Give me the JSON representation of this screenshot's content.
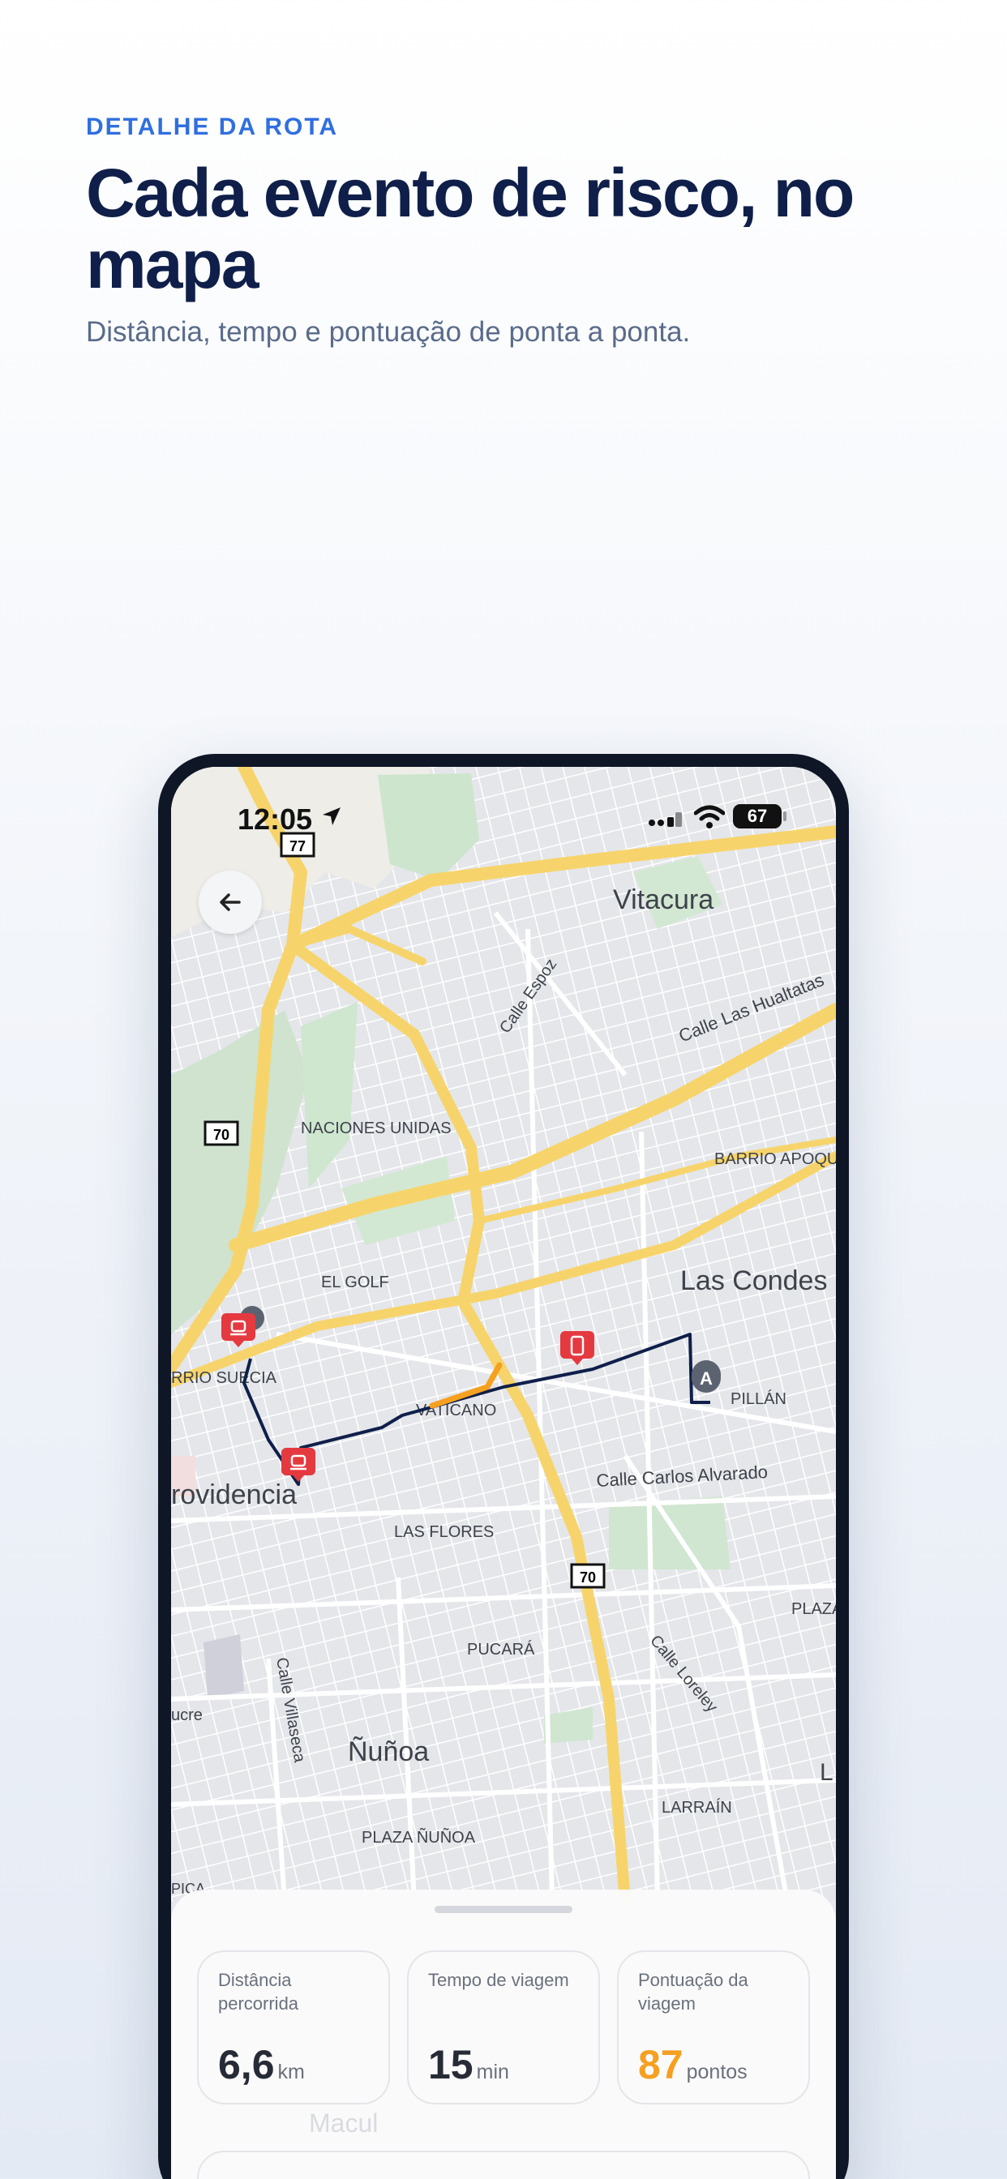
{
  "hero": {
    "eyebrow": "DETALHE DA ROTA",
    "title": "Cada evento de risco, no mapa",
    "subtitle": "Distância, tempo e pontuação de ponta a ponta."
  },
  "status_bar": {
    "time": "12:05",
    "battery": "67",
    "icons": [
      "location-arrow-icon",
      "signal-icon",
      "wifi-icon",
      "battery-icon"
    ]
  },
  "map": {
    "road_shields": [
      "77",
      "70",
      "70"
    ],
    "labels": {
      "vitacura": "Vitacura",
      "calle_espoz": "Calle Espoz",
      "calle_las_hualtatas": "Calle Las Hualtatas",
      "naciones_unidas": "NACIONES UNIDAS",
      "barrio_apoquindo": "BARRIO APOQUI",
      "el_golf": "EL GOLF",
      "las_condes": "Las Condes",
      "barrio_suecia": "RRIO SUECIA",
      "vaticano": "VATICANO",
      "el_pillan": "PILLÁN",
      "providencia": "rovidencia",
      "calle_carlos_alvarado": "Calle Carlos Alvarado",
      "las_flores": "LAS FLORES",
      "plaza": "PLAZA",
      "calle_loreley": "Calle Loreley",
      "pucara": "PUCARÁ",
      "calle_villaseca": "Calle Villaseca",
      "sucre": "ucre",
      "nunoa": "Ñuñoa",
      "larrain": "LARRAÍN",
      "plaza_nunoa": "PLAZA ÑUÑOA",
      "edge_l": "L",
      "pica": "PICA",
      "macul": "Macul"
    },
    "start_marker": "A",
    "event_markers": [
      "car-event-icon",
      "car-event-icon",
      "phone-event-icon"
    ],
    "colors": {
      "route": "#0f1f4a",
      "speeding_segment": "#f5a020",
      "event_marker": "#e53940",
      "highway": "#f7d46b",
      "park": "#cfe6cf"
    }
  },
  "stats": {
    "distance": {
      "label": "Distância percorrida",
      "value": "6,6",
      "unit": "km"
    },
    "duration": {
      "label": "Tempo de viagem",
      "value": "15",
      "unit": "min"
    },
    "score": {
      "label": "Pontuação da viagem",
      "value": "87",
      "unit": "pontos",
      "color": "#f5a020"
    }
  }
}
